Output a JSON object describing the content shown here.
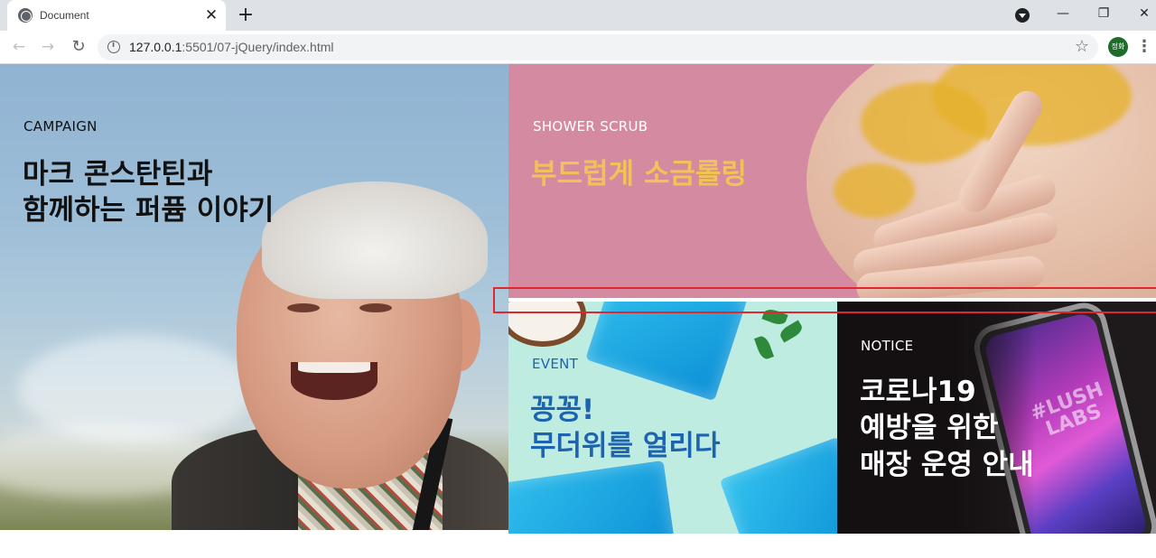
{
  "browser": {
    "tab_title": "Document",
    "tab_close": "✕",
    "new_tab": "+",
    "url_host": "127.0.0.1",
    "url_rest": ":5501/07-jQuery/index.html",
    "avatar_text": "정화",
    "nav": {
      "back": "←",
      "forward": "→",
      "reload": "↻"
    },
    "window": {
      "minimize": "—",
      "restore": "❐",
      "close": "✕"
    },
    "icons": [
      "globe-icon",
      "info-icon",
      "star-icon",
      "menu-icon",
      "profile-icon"
    ]
  },
  "campaign": {
    "label": "CAMPAIGN",
    "heading": [
      "마크 콘스탄틴과",
      "함께하는 퍼퓸 이야기"
    ]
  },
  "shower": {
    "label": "SHOWER SCRUB",
    "heading": [
      "부드럽게 소금롤링"
    ]
  },
  "event": {
    "label": "EVENT",
    "heading": [
      "꽁꽁!",
      "무더위를 얼리다"
    ]
  },
  "notice": {
    "label": "NOTICE",
    "heading": [
      "코로나19",
      "예방을 위한",
      "매장 운영 안내"
    ],
    "phone_text": "#LUSH LABS"
  },
  "colors": {
    "highlight_border": "#e0262f",
    "shower_bg": "#d48aa0",
    "event_bg": "#bfece1",
    "notice_bg": "#1e1a1b",
    "gold_text": "#f2c25a",
    "blue_text": "#1e63b0"
  }
}
